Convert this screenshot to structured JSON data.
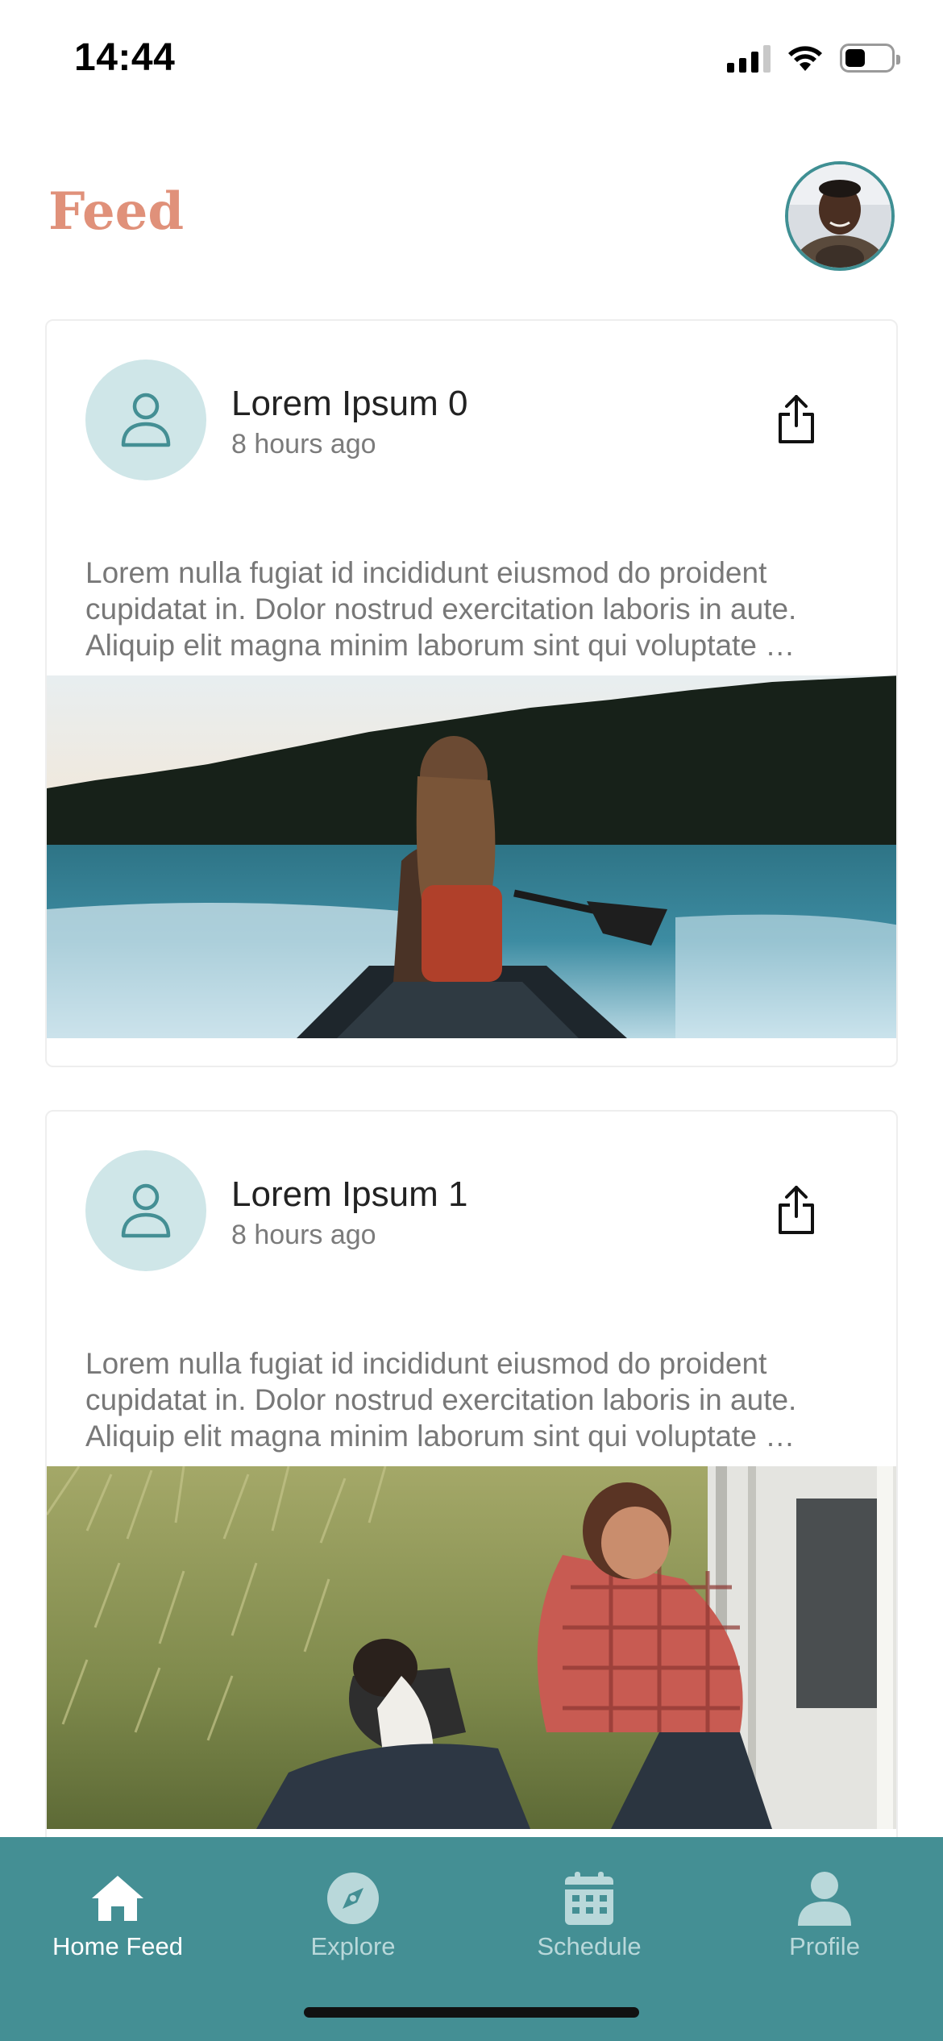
{
  "status_bar": {
    "time": "14:44",
    "battery_level": 0.45,
    "signal_bars": 3,
    "wifi": true
  },
  "header": {
    "title": "Feed"
  },
  "posts": [
    {
      "user": "Lorem Ipsum 0",
      "time": "8 hours ago",
      "body": "Lorem nulla fugiat id incididunt eiusmod do proident cupidatat in. Dolor nostrud exercitation laboris in aute. Aliquip elit magna minim laborum sint qui voluptate …",
      "image": "woman-canoe-lake-photo"
    },
    {
      "user": "Lorem Ipsum 1",
      "time": "8 hours ago",
      "body": "Lorem nulla fugiat id incididunt eiusmod do proident cupidatat in. Dolor nostrud exercitation laboris in aute. Aliquip elit magna minim laborum sint qui voluptate …",
      "image": "man-dog-grass-photo"
    }
  ],
  "tab_bar": {
    "items": [
      {
        "label": "Home Feed",
        "icon": "home-icon",
        "active": true
      },
      {
        "label": "Explore",
        "icon": "compass-icon",
        "active": false
      },
      {
        "label": "Schedule",
        "icon": "calendar-icon",
        "active": false
      },
      {
        "label": "Profile",
        "icon": "person-icon",
        "active": false
      }
    ]
  },
  "colors": {
    "accent": "#448f94",
    "title": "#e0917a",
    "avatar_bg": "#cfe6e8",
    "tab_inactive": "#b9d8da"
  }
}
